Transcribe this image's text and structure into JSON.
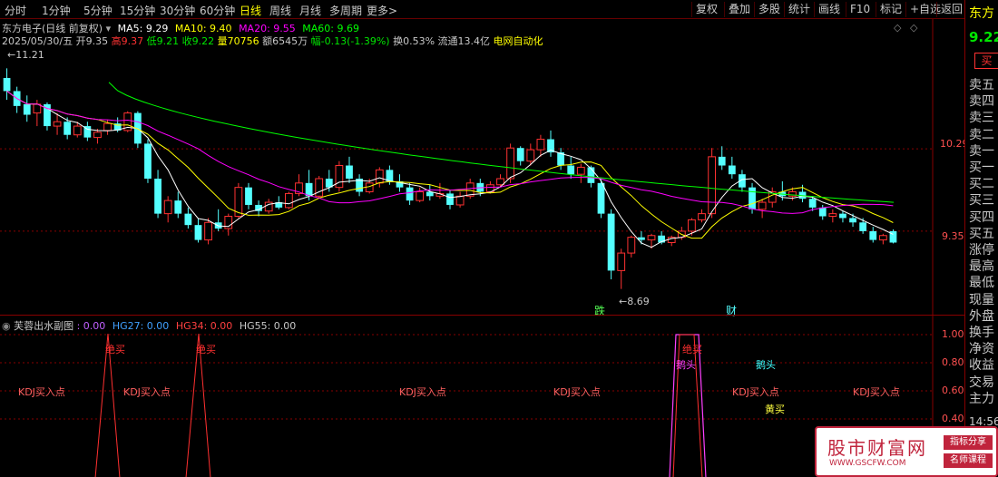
{
  "toolbar": {
    "periods": [
      "分时",
      "1分钟",
      "5分钟",
      "15分钟",
      "30分钟",
      "60分钟",
      "日线",
      "周线",
      "月线",
      "多周期",
      "更多>"
    ],
    "active_period": "日线",
    "buttons": [
      "复权",
      "叠加",
      "多股",
      "统计",
      "画线",
      "F10",
      "标记",
      "+自选",
      "返回"
    ]
  },
  "header": {
    "stock_title": "东方电子(日线 前复权)",
    "ma5": "MA5: 9.29",
    "ma10": "MA10: 9.40",
    "ma20": "MA20: 9.55",
    "ma60": "MA60: 9.69",
    "date": "2025/05/30/五",
    "open": "开9.35",
    "high": "高9.37",
    "low": "低9.21",
    "close": "收9.22",
    "volume": "量70756",
    "amount": "额6545万",
    "change": "幅-0.13(-1.39%)",
    "turnover": "换0.53%",
    "float_cap": "流通13.4亿",
    "concept": "电网自动化"
  },
  "main_chart": {
    "high_marker": "11.21",
    "low_marker": "8.69",
    "price_labels": [
      "10.29",
      "9.35"
    ],
    "event_labels": [
      "跌",
      "财"
    ],
    "colors": {
      "up": "#ff3232",
      "down": "#54ffff",
      "ma5": "#ffffff",
      "ma10": "#ffff00",
      "ma20": "#ff00ff",
      "ma60": "#00ff00"
    }
  },
  "chart_data": {
    "type": "candlestick",
    "title": "东方电子(日线 前复权)",
    "ylim": [
      8.5,
      11.4
    ],
    "candles": [
      [
        11.1,
        11.21,
        10.85,
        10.95
      ],
      [
        10.95,
        11.0,
        10.7,
        10.78
      ],
      [
        10.8,
        10.9,
        10.6,
        10.68
      ],
      [
        10.7,
        10.85,
        10.55,
        10.8
      ],
      [
        10.8,
        10.82,
        10.5,
        10.55
      ],
      [
        10.55,
        10.7,
        10.45,
        10.6
      ],
      [
        10.6,
        10.65,
        10.4,
        10.45
      ],
      [
        10.45,
        10.6,
        10.42,
        10.55
      ],
      [
        10.55,
        10.6,
        10.38,
        10.42
      ],
      [
        10.42,
        10.52,
        10.35,
        10.48
      ],
      [
        10.5,
        10.62,
        10.45,
        10.58
      ],
      [
        10.58,
        10.65,
        10.48,
        10.5
      ],
      [
        10.5,
        10.72,
        10.48,
        10.7
      ],
      [
        10.7,
        10.72,
        10.3,
        10.35
      ],
      [
        10.35,
        10.4,
        9.9,
        9.95
      ],
      [
        9.95,
        10.05,
        9.5,
        9.55
      ],
      [
        9.55,
        9.75,
        9.45,
        9.7
      ],
      [
        9.7,
        9.8,
        9.5,
        9.55
      ],
      [
        9.55,
        9.62,
        9.38,
        9.42
      ],
      [
        9.42,
        9.5,
        9.22,
        9.25
      ],
      [
        9.25,
        9.5,
        9.2,
        9.45
      ],
      [
        9.45,
        9.6,
        9.35,
        9.38
      ],
      [
        9.38,
        9.55,
        9.3,
        9.52
      ],
      [
        9.52,
        9.9,
        9.5,
        9.85
      ],
      [
        9.85,
        9.9,
        9.6,
        9.65
      ],
      [
        9.65,
        9.7,
        9.52,
        9.58
      ],
      [
        9.58,
        9.72,
        9.55,
        9.68
      ],
      [
        9.68,
        9.75,
        9.6,
        9.62
      ],
      [
        9.62,
        9.8,
        9.6,
        9.78
      ],
      [
        9.78,
        10.0,
        9.75,
        9.9
      ],
      [
        9.9,
        10.05,
        9.7,
        9.75
      ],
      [
        9.75,
        9.98,
        9.72,
        9.95
      ],
      [
        9.95,
        10.05,
        9.8,
        9.85
      ],
      [
        9.85,
        10.15,
        9.8,
        10.1
      ],
      [
        10.1,
        10.2,
        9.9,
        9.95
      ],
      [
        9.95,
        10.0,
        9.75,
        9.8
      ],
      [
        9.8,
        9.95,
        9.78,
        9.9
      ],
      [
        9.9,
        10.08,
        9.85,
        10.05
      ],
      [
        10.05,
        10.1,
        9.88,
        9.92
      ],
      [
        9.92,
        10.0,
        9.8,
        9.85
      ],
      [
        9.85,
        9.9,
        9.65,
        9.7
      ],
      [
        9.7,
        9.85,
        9.68,
        9.8
      ],
      [
        9.8,
        9.88,
        9.7,
        9.75
      ],
      [
        9.75,
        9.9,
        9.72,
        9.78
      ],
      [
        9.78,
        9.82,
        9.6,
        9.65
      ],
      [
        9.65,
        9.8,
        9.62,
        9.75
      ],
      [
        9.75,
        9.95,
        9.72,
        9.9
      ],
      [
        9.9,
        9.95,
        9.75,
        9.8
      ],
      [
        9.8,
        9.92,
        9.78,
        9.88
      ],
      [
        9.88,
        10.0,
        9.85,
        9.95
      ],
      [
        9.95,
        10.35,
        9.9,
        10.3
      ],
      [
        10.3,
        10.32,
        10.1,
        10.15
      ],
      [
        10.15,
        10.35,
        10.1,
        10.28
      ],
      [
        10.28,
        10.45,
        10.2,
        10.4
      ],
      [
        10.4,
        10.5,
        10.2,
        10.25
      ],
      [
        10.25,
        10.3,
        10.05,
        10.1
      ],
      [
        10.1,
        10.2,
        9.95,
        10.0
      ],
      [
        10.0,
        10.12,
        9.9,
        10.08
      ],
      [
        10.08,
        10.1,
        9.85,
        9.9
      ],
      [
        9.9,
        9.95,
        9.5,
        9.55
      ],
      [
        9.55,
        9.6,
        8.8,
        8.9
      ],
      [
        8.9,
        9.15,
        8.69,
        9.1
      ],
      [
        9.1,
        9.3,
        9.05,
        9.28
      ],
      [
        9.28,
        9.35,
        9.2,
        9.25
      ],
      [
        9.25,
        9.32,
        9.15,
        9.3
      ],
      [
        9.3,
        9.35,
        9.2,
        9.22
      ],
      [
        9.22,
        9.3,
        9.18,
        9.28
      ],
      [
        9.28,
        9.4,
        9.25,
        9.35
      ],
      [
        9.35,
        9.5,
        9.3,
        9.48
      ],
      [
        9.48,
        9.6,
        9.45,
        9.55
      ],
      [
        9.55,
        10.3,
        9.5,
        10.2
      ],
      [
        10.2,
        10.32,
        10.05,
        10.1
      ],
      [
        10.1,
        10.2,
        9.95,
        10.0
      ],
      [
        10.0,
        10.05,
        9.8,
        9.85
      ],
      [
        9.85,
        9.9,
        9.55,
        9.6
      ],
      [
        9.6,
        9.72,
        9.5,
        9.68
      ],
      [
        9.68,
        9.85,
        9.62,
        9.8
      ],
      [
        9.8,
        9.92,
        9.7,
        9.75
      ],
      [
        9.75,
        9.85,
        9.7,
        9.8
      ],
      [
        9.8,
        9.88,
        9.68,
        9.72
      ],
      [
        9.72,
        9.75,
        9.58,
        9.62
      ],
      [
        9.62,
        9.65,
        9.48,
        9.52
      ],
      [
        9.52,
        9.6,
        9.45,
        9.55
      ],
      [
        9.55,
        9.58,
        9.45,
        9.5
      ],
      [
        9.5,
        9.55,
        9.4,
        9.45
      ],
      [
        9.45,
        9.5,
        9.32,
        9.35
      ],
      [
        9.35,
        9.4,
        9.22,
        9.25
      ],
      [
        9.25,
        9.32,
        9.2,
        9.3
      ],
      [
        9.35,
        9.37,
        9.21,
        9.22
      ]
    ],
    "ma5_last": 9.29,
    "ma10_last": 9.4,
    "ma20_last": 9.55,
    "ma60_last": 9.69
  },
  "sub_chart": {
    "title": "芙蓉出水副图",
    "values": [
      ": 0.00",
      "HG27: 0.00",
      "HG34: 0.00",
      "HG55: 0.00"
    ],
    "y_labels": [
      "1.00",
      "0.80",
      "0.60",
      "0.40"
    ],
    "signals": [
      {
        "text": "KDJ买入点",
        "color": "#ff6060"
      },
      {
        "text": "KDJ买入点",
        "color": "#ff6060"
      },
      {
        "text": "KDJ买入点",
        "color": "#ff6060"
      },
      {
        "text": "KDJ买入点",
        "color": "#ff6060"
      },
      {
        "text": "KDJ买入点",
        "color": "#ff6060"
      },
      {
        "text": "KDJ买入点",
        "color": "#ff6060"
      },
      {
        "text": "绝买",
        "color": "#ff3030"
      },
      {
        "text": "绝买",
        "color": "#ff3030"
      },
      {
        "text": "绝买",
        "color": "#ff3030"
      },
      {
        "text": "鹅头",
        "color": "#ff40ff"
      },
      {
        "text": "鹅头",
        "color": "#40ffff"
      },
      {
        "text": "黄买",
        "color": "#ffff40"
      }
    ]
  },
  "sidebar": {
    "name": "东方",
    "price": "9.22",
    "buy_button": "买",
    "rows": [
      "卖五",
      "卖四",
      "卖三",
      "卖二",
      "卖一",
      "买一",
      "买二",
      "买三",
      "买四",
      "买五",
      "涨停",
      "最高",
      "最低",
      "现量",
      "外盘",
      "换手",
      "净资",
      "收益",
      "交易",
      "主力"
    ],
    "time": "14:56"
  },
  "watermark": {
    "main": "股市财富网",
    "url": "WWW.GSCFW.COM",
    "tag1": "指标分享",
    "tag2": "名师课程"
  }
}
